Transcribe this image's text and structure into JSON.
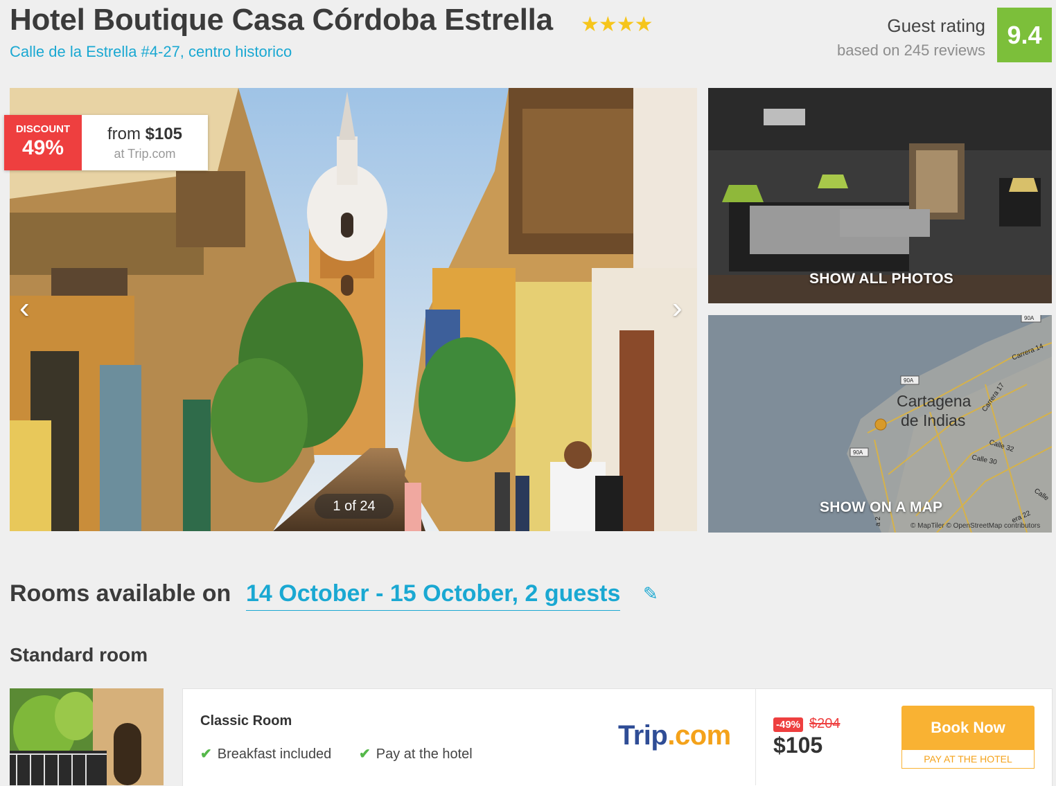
{
  "hotel": {
    "name": "Hotel Boutique Casa Córdoba Estrella",
    "stars": "★★★★",
    "address": "Calle de la Estrella #4-27, centro historico"
  },
  "rating": {
    "label": "Guest rating",
    "reviews": "based on 245 reviews",
    "score": "9.4",
    "score_color": "#7cbf3a"
  },
  "gallery": {
    "discount_label": "DISCOUNT",
    "discount_value": "49%",
    "from_text": "from",
    "from_price": "$105",
    "from_site": "at Trip.com",
    "prev_icon": "chevron-left-icon",
    "next_icon": "chevron-right-icon",
    "counter": "1 of 24",
    "show_photos": "SHOW ALL PHOTOS",
    "show_map": "SHOW ON A MAP"
  },
  "map": {
    "city_line1": "Cartagena",
    "city_line2": "de Indias",
    "road_labels": [
      "90A",
      "90A",
      "90A",
      "Carrera 14",
      "Carrera 17",
      "Calle 32",
      "Calle 30",
      "Calle",
      "era 22",
      "a 2"
    ],
    "credit": "© MapTiler © OpenStreetMap contributors"
  },
  "rooms": {
    "heading_prefix": "Rooms available on",
    "dates": "14 October - 15 October, 2 guests",
    "edit_icon": "pencil-icon",
    "room_type": "Standard room"
  },
  "offer": {
    "name": "Classic Room",
    "features": [
      "Breakfast included",
      "Pay at the hotel"
    ],
    "provider": "Trip",
    "provider_suffix": ".com",
    "discount_badge": "-49%",
    "old_price": "$204",
    "new_price": "$105",
    "book_label": "Book Now",
    "pay_label": "PAY AT THE HOTEL",
    "accent": "#f9b233",
    "sale_color": "#ee3f3f"
  }
}
